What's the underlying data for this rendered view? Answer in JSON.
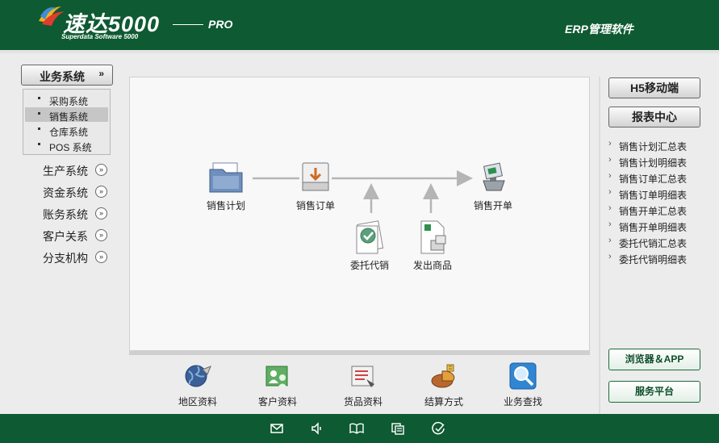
{
  "header": {
    "logo_text": "速达5000",
    "logo_sub": "Superdata Software 5000",
    "edition": "PRO",
    "product": "ERP管理软件"
  },
  "nav": {
    "section_label": "业务系统",
    "section_icon": "double-chevron-down-icon",
    "sub_items": [
      {
        "label": "采购系统",
        "active": false
      },
      {
        "label": "销售系统",
        "active": true
      },
      {
        "label": "仓库系统",
        "active": false
      },
      {
        "label": "POS 系统",
        "active": false
      }
    ],
    "items": [
      {
        "label": "生产系统"
      },
      {
        "label": "资金系统"
      },
      {
        "label": "账务系统"
      },
      {
        "label": "客户关系"
      },
      {
        "label": "分支机构"
      }
    ]
  },
  "flow": {
    "nodes": [
      {
        "label": "销售计划",
        "icon": "folder-document-icon"
      },
      {
        "label": "销售订单",
        "icon": "inbox-tray-icon"
      },
      {
        "label": "销售开单",
        "icon": "cash-register-icon"
      },
      {
        "label": "委托代销",
        "icon": "approved-document-icon"
      },
      {
        "label": "发出商品",
        "icon": "shipping-document-icon"
      }
    ]
  },
  "shortcuts": [
    {
      "label": "地区资料",
      "icon": "globe-icon"
    },
    {
      "label": "客户资料",
      "icon": "customer-group-icon"
    },
    {
      "label": "货品资料",
      "icon": "goods-list-icon"
    },
    {
      "label": "结算方式",
      "icon": "settlement-pie-icon"
    },
    {
      "label": "业务查找",
      "icon": "magnifier-icon"
    }
  ],
  "right": {
    "mobile_button": "H5移动端",
    "report_button": "报表中心",
    "reports": [
      "销售计划汇总表",
      "销售计划明细表",
      "销售订单汇总表",
      "销售订单明细表",
      "销售开单汇总表",
      "销售开单明细表",
      "委托代销汇总表",
      "委托代销明细表"
    ],
    "browser_button": "浏览器＆APP",
    "service_button": "服务平台"
  },
  "footer": {
    "icons": [
      "mail-icon",
      "speaker-icon",
      "book-icon",
      "window-list-icon",
      "check-circle-icon"
    ]
  },
  "colors": {
    "brand_green": "#0e5a32",
    "panel_bg": "#f8f8f8",
    "flow_line": "#b5b5b5"
  }
}
